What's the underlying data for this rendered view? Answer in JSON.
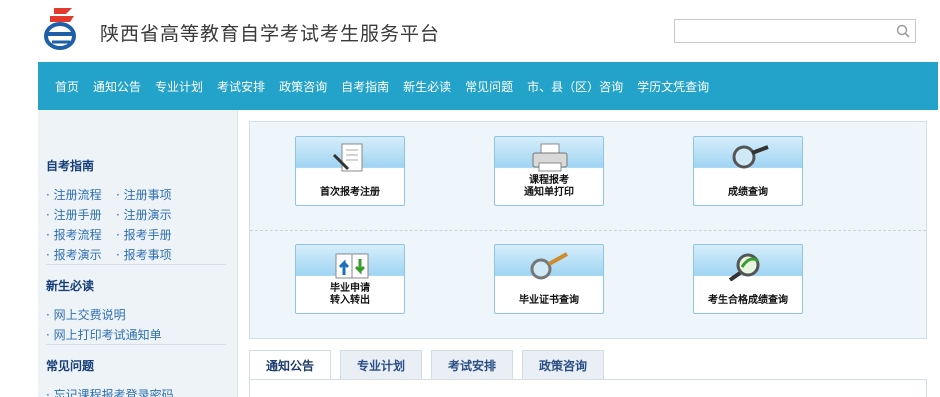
{
  "header": {
    "title": "陕西省高等教育自学考试考生服务平台",
    "search_placeholder": ""
  },
  "nav": [
    "首页",
    "通知公告",
    "专业计划",
    "考试安排",
    "政策咨询",
    "自考指南",
    "新生必读",
    "常见问题",
    "市、县（区）咨询",
    "学历文凭查询"
  ],
  "sidebar": {
    "sections": [
      {
        "title": "自考指南",
        "links": [
          "注册流程",
          "注册事项",
          "注册手册",
          "注册演示",
          "报考流程",
          "报考手册",
          "报考演示",
          "报考事项"
        ]
      },
      {
        "title": "新生必读",
        "links": [
          "网上交费说明",
          "网上打印考试通知单"
        ]
      },
      {
        "title": "常见问题",
        "links": [
          "忘记课程报考登录密码"
        ]
      }
    ]
  },
  "tiles": [
    {
      "label": "首次报考注册",
      "icon": "document-pen-icon"
    },
    {
      "label": "课程报考\n通知单打印",
      "icon": "printer-icon"
    },
    {
      "label": "成绩查询",
      "icon": "magnifier-icon"
    },
    {
      "label": "毕业申请\n转入转出",
      "icon": "transfer-docs-icon"
    },
    {
      "label": "毕业证书查询",
      "icon": "magnifier-icon"
    },
    {
      "label": "考生合格成绩查询",
      "icon": "magnifier-arrow-icon"
    }
  ],
  "tabs": [
    "通知公告",
    "专业计划",
    "考试安排",
    "政策咨询"
  ],
  "colors": {
    "nav": "#24a3ca",
    "sidebar_bg": "#eef3f7",
    "sidebar_title": "#163e7a",
    "link": "#2f6fb3"
  }
}
